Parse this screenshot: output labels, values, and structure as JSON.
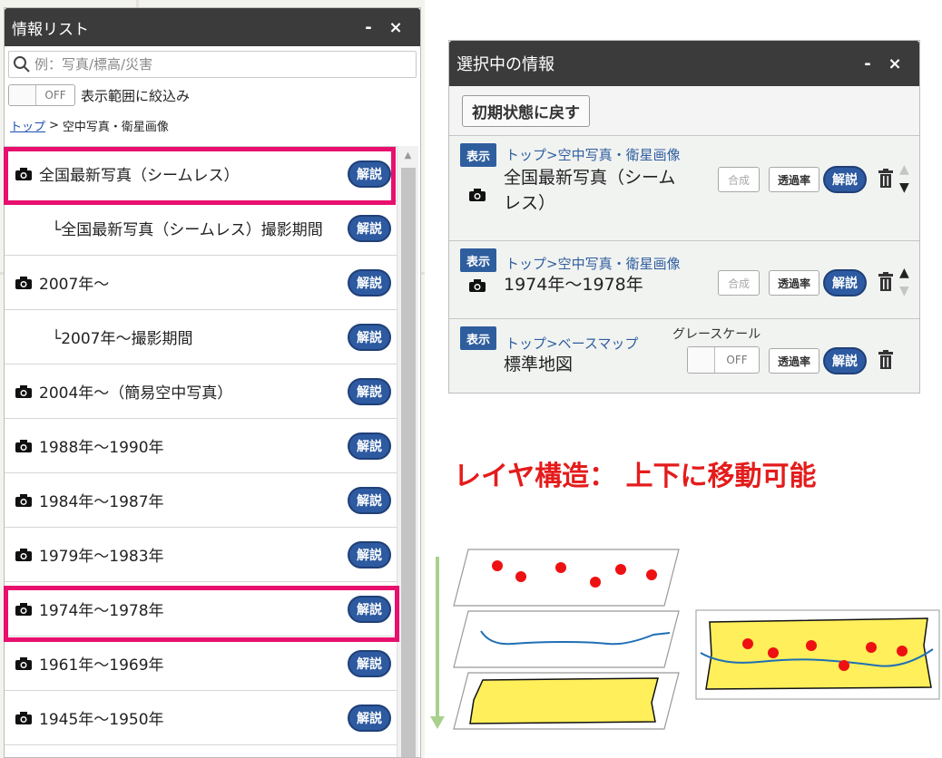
{
  "info_panel": {
    "title": "情報リスト",
    "minimize": "-",
    "close": "×",
    "search": {
      "placeholder": "例：写真/標高/災害"
    },
    "filter": {
      "toggle_state": "OFF",
      "label": "表示範囲に絞込み"
    },
    "breadcrumb": {
      "top": "トップ",
      "separator": ">",
      "current": "空中写真・衛星画像"
    },
    "items": [
      {
        "label": "全国最新写真（シームレス）",
        "icon": "camera-icon",
        "sub": false,
        "highlighted": true
      },
      {
        "label": "└全国最新写真（シームレス）撮影期間",
        "icon": "",
        "sub": true,
        "highlighted": false
      },
      {
        "label": "2007年～",
        "icon": "camera-icon",
        "sub": false,
        "highlighted": false
      },
      {
        "label": "└2007年～撮影期間",
        "icon": "",
        "sub": true,
        "highlighted": false
      },
      {
        "label": "2004年～（簡易空中写真）",
        "icon": "camera-icon",
        "sub": false,
        "highlighted": false
      },
      {
        "label": "1988年～1990年",
        "icon": "camera-icon",
        "sub": false,
        "highlighted": false
      },
      {
        "label": "1984年～1987年",
        "icon": "camera-icon",
        "sub": false,
        "highlighted": false
      },
      {
        "label": "1979年～1983年",
        "icon": "camera-icon",
        "sub": false,
        "highlighted": false
      },
      {
        "label": "1974年～1978年",
        "icon": "camera-icon",
        "sub": false,
        "highlighted": true
      },
      {
        "label": "1961年～1969年",
        "icon": "camera-icon",
        "sub": false,
        "highlighted": false
      },
      {
        "label": "1945年～1950年",
        "icon": "camera-icon",
        "sub": false,
        "highlighted": false
      }
    ],
    "kaisetsu_label": "解説",
    "highlight_color": "#e8106e"
  },
  "selected_panel": {
    "title": "選択中の情報",
    "minimize": "-",
    "close": "×",
    "reset_label": "初期状態に戻す",
    "show_label": "表示",
    "composite_label": "合成",
    "transparency_label": "透過率",
    "kaisetsu_label": "解説",
    "layers": [
      {
        "path": "トップ>空中写真・衛星画像",
        "title_line1": "全国最新写真（シーム",
        "title_line2": "レス）",
        "icon": "camera-icon"
      },
      {
        "path": "トップ>空中写真・衛星画像",
        "title_line1": "1974年～1978年",
        "icon": "camera-icon"
      },
      {
        "path": "トップ>ベースマップ",
        "title_line1": "標準地図",
        "grayscale_label": "グレースケール",
        "toggle_state": "OFF"
      }
    ]
  },
  "annotation": {
    "headline": "レイヤ構造： 上下に移動可能",
    "color": "#e41c1c"
  },
  "colors": {
    "header_bg": "#3b3b3b",
    "accent_blue": "#2d5aa0",
    "layer_fill": "#ffef5a",
    "river": "#1f6fb5",
    "points": "#ee1111",
    "arrow": "#a9d18e"
  }
}
